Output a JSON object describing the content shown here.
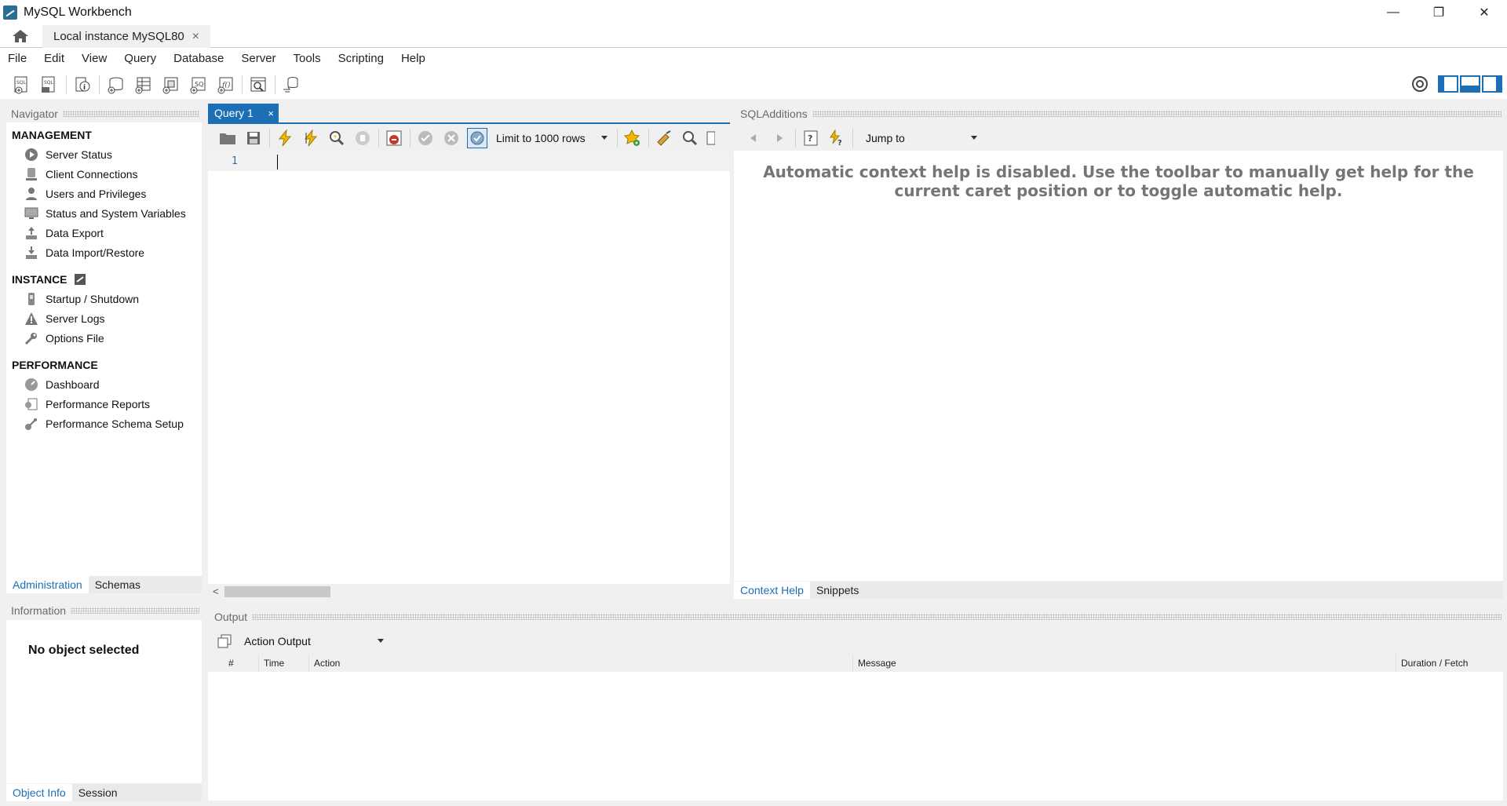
{
  "window": {
    "title": "MySQL Workbench",
    "minimize": "—",
    "restore": "❐",
    "close": "✕"
  },
  "connection_tab": {
    "label": "Local instance MySQL80",
    "close": "×"
  },
  "menu": [
    "File",
    "Edit",
    "View",
    "Query",
    "Database",
    "Server",
    "Tools",
    "Scripting",
    "Help"
  ],
  "navigator": {
    "title": "Navigator",
    "management": {
      "heading": "MANAGEMENT",
      "items": [
        "Server Status",
        "Client Connections",
        "Users and Privileges",
        "Status and System Variables",
        "Data Export",
        "Data Import/Restore"
      ]
    },
    "instance": {
      "heading": "INSTANCE",
      "items": [
        "Startup / Shutdown",
        "Server Logs",
        "Options File"
      ]
    },
    "performance": {
      "heading": "PERFORMANCE",
      "items": [
        "Dashboard",
        "Performance Reports",
        "Performance Schema Setup"
      ]
    },
    "tabs": [
      "Administration",
      "Schemas"
    ]
  },
  "information": {
    "title": "Information",
    "message": "No object selected",
    "tabs": [
      "Object Info",
      "Session"
    ]
  },
  "editor": {
    "tab_label": "Query 1",
    "tab_close": "×",
    "limit_value": "Limit to 1000 rows",
    "line_number": "1"
  },
  "sql_additions": {
    "title": "SQLAdditions",
    "jump_to": "Jump to",
    "help_message": "Automatic context help is disabled. Use the toolbar to manually get help for the current caret position or to toggle automatic help.",
    "tabs": [
      "Context Help",
      "Snippets"
    ]
  },
  "output": {
    "title": "Output",
    "selector_value": "Action Output",
    "columns": [
      "#",
      "Time",
      "Action",
      "Message",
      "Duration / Fetch"
    ]
  },
  "colors": {
    "accent": "#1c6fb5",
    "panel_bg": "#f0f0f0",
    "help_text": "#757575"
  }
}
